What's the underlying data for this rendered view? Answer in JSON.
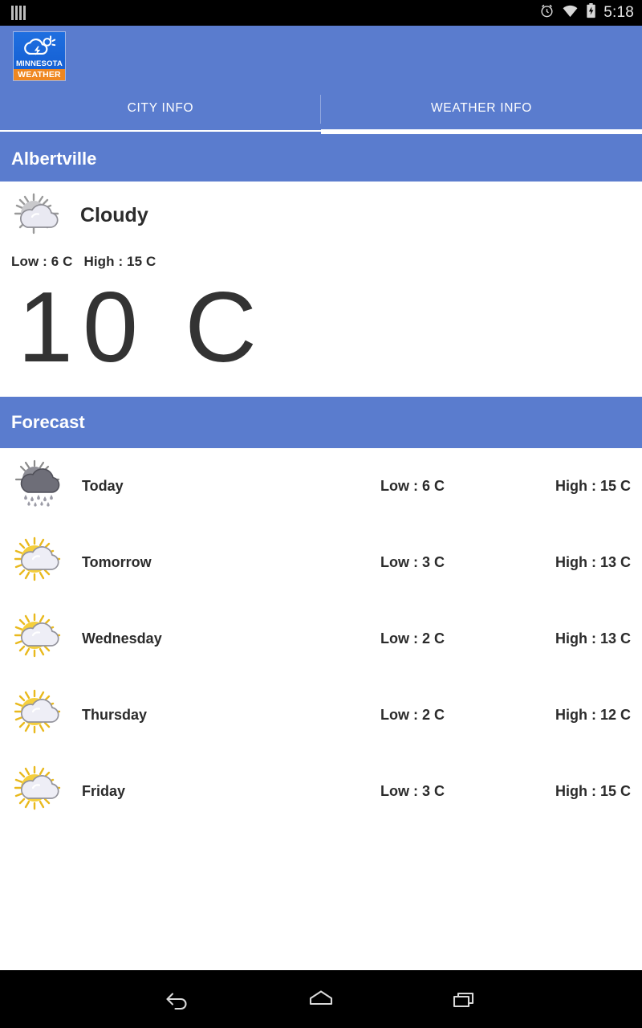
{
  "statusbar": {
    "time": "5:18",
    "icons": [
      "signal-bars-icon",
      "alarm-icon",
      "wifi-icon",
      "battery-charging-icon"
    ]
  },
  "appbar": {
    "logo_line1": "MINNESOTA",
    "logo_line2": "WEATHER",
    "logo_icon": "cloud-sun-lightning-icon",
    "brand_blue": "#1763d6",
    "brand_orange": "#ef8721"
  },
  "theme": {
    "accent": "#5a7cce",
    "text_dark": "#2b2b2b",
    "big_temp_color": "#333333"
  },
  "tabs": [
    {
      "label": "CITY INFO",
      "active": false
    },
    {
      "label": "WEATHER INFO",
      "active": true
    }
  ],
  "city_section": {
    "title": "Albertville"
  },
  "current": {
    "icon": "cloudy-sun-icon",
    "condition": "Cloudy",
    "low": "Low : 6 C",
    "high": "High : 15 C",
    "temperature": "10 C"
  },
  "forecast_section": {
    "title": "Forecast",
    "rows": [
      {
        "icon": "rain-cloud-icon",
        "day": "Today",
        "low": "Low : 6 C",
        "high": "High : 15 C"
      },
      {
        "icon": "sun-cloud-icon",
        "day": "Tomorrow",
        "low": "Low : 3 C",
        "high": "High : 13 C"
      },
      {
        "icon": "sun-cloud-icon",
        "day": "Wednesday",
        "low": "Low : 2 C",
        "high": "High : 13 C"
      },
      {
        "icon": "sun-cloud-icon",
        "day": "Thursday",
        "low": "Low : 2 C",
        "high": "High : 12 C"
      },
      {
        "icon": "sun-cloud-icon",
        "day": "Friday",
        "low": "Low : 3 C",
        "high": "High : 15 C"
      }
    ]
  },
  "navbar": {
    "back": "back-icon",
    "home": "home-icon",
    "recents": "recents-icon"
  }
}
